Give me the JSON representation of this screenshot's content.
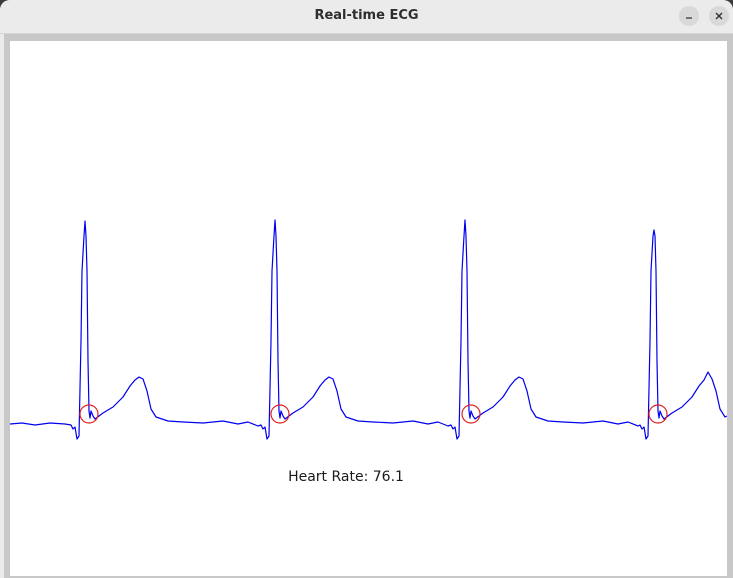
{
  "window": {
    "title": "Real-time ECG",
    "minimize_icon": "minimize-icon",
    "close_icon": "close-icon"
  },
  "plot": {
    "trace_color": "#0000ee",
    "marker_color": "#e02020",
    "background": "#ffffff",
    "beat_count": 4
  },
  "readout": {
    "label": "Heart Rate: ",
    "value": "76.1"
  }
}
